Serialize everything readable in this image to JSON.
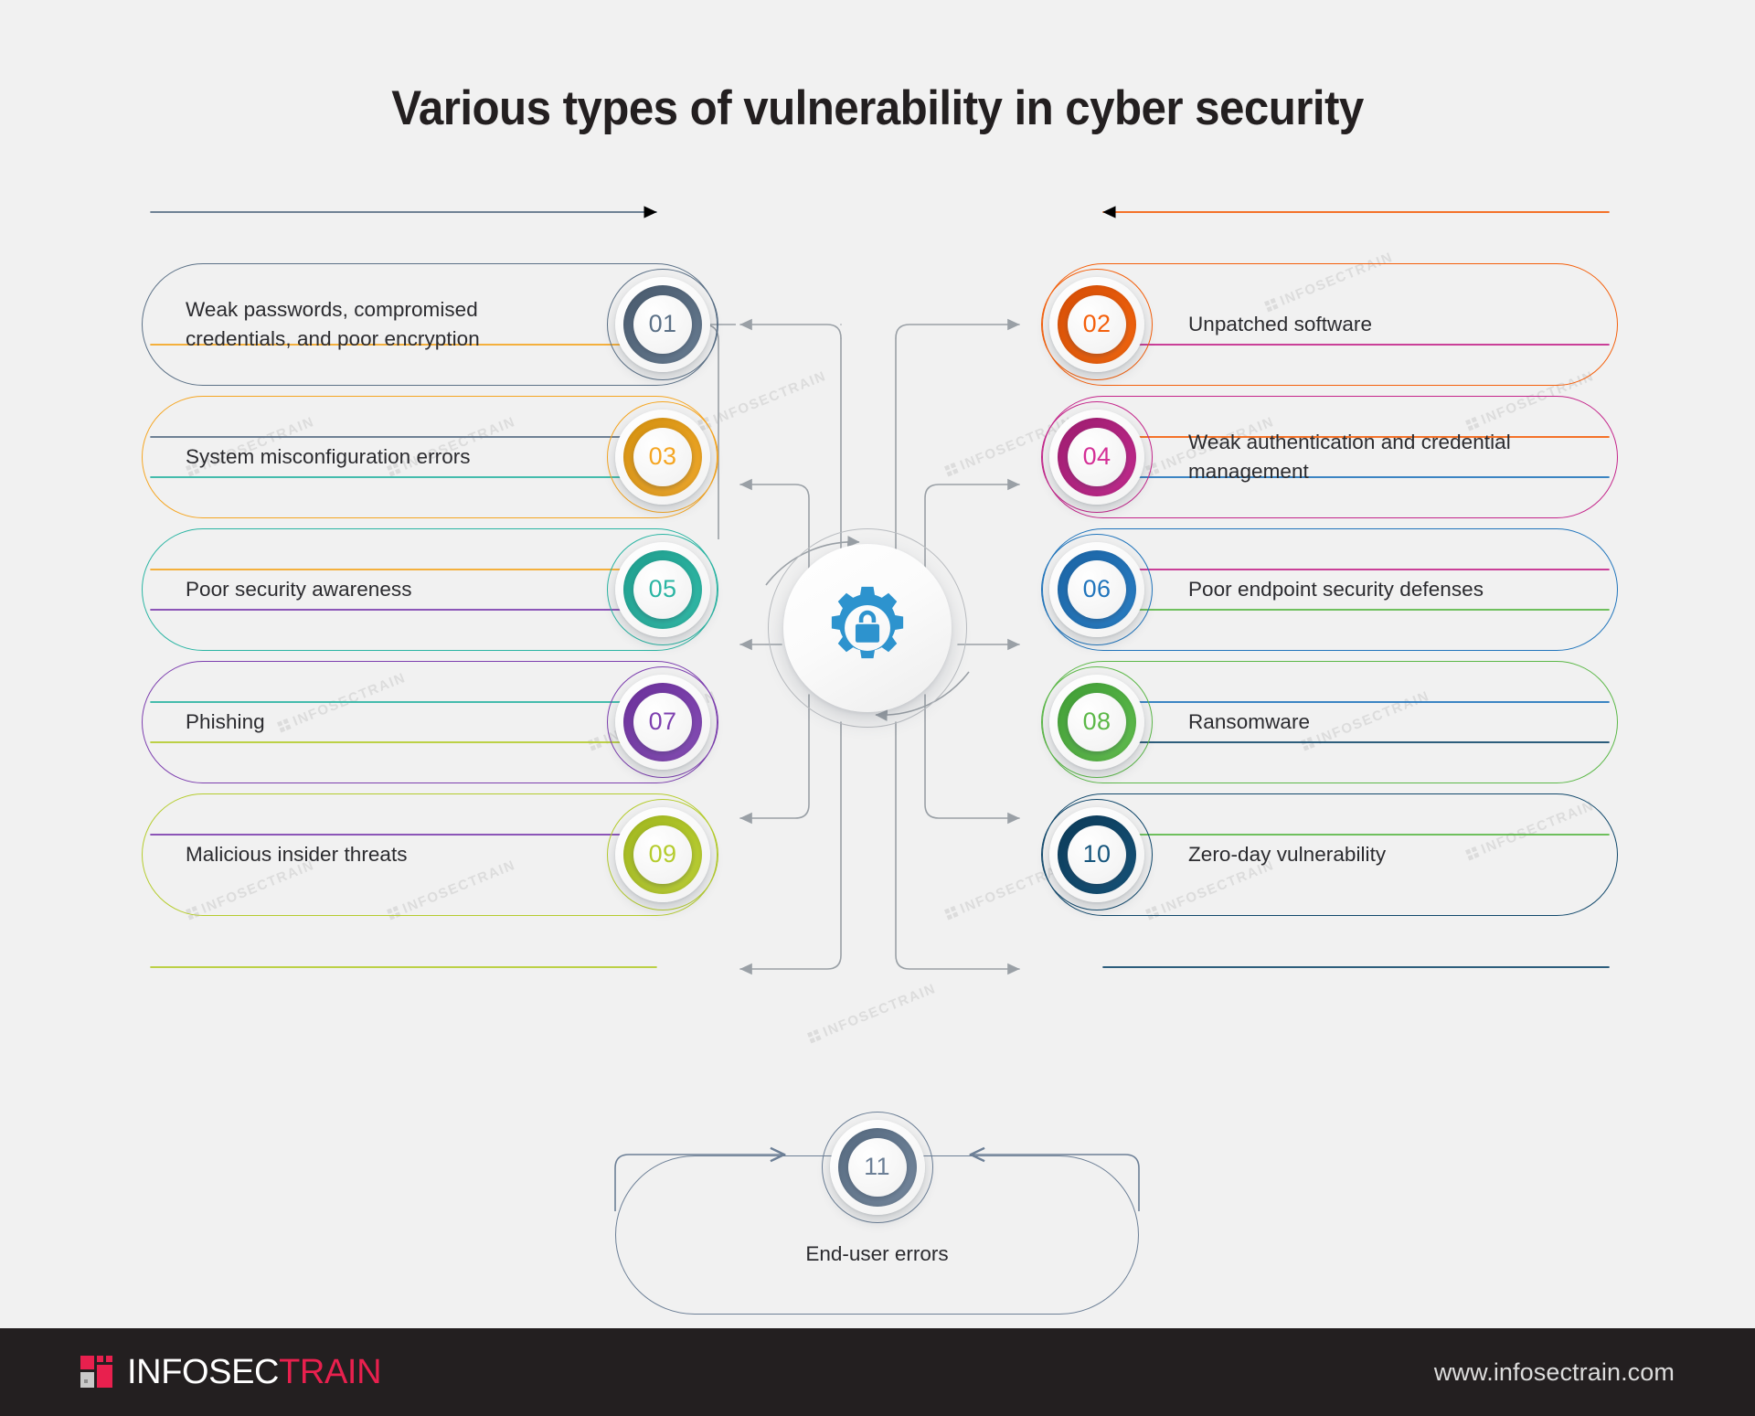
{
  "page": {
    "title": "Various types of vulnerability in cyber security",
    "background_color": "#f1f1f1",
    "watermark_text": "INFOSECTRAIN"
  },
  "hub": {
    "icon": "gear-lock-icon",
    "icon_color": "#2d93ce"
  },
  "items": [
    {
      "number": "01",
      "label": "Weak passwords, compromised credentials, and poor encryption",
      "side": "left",
      "color": "#5c7187",
      "color_dark": "#47586b",
      "color_light": "#6d8298",
      "number_color": "#5c7187"
    },
    {
      "number": "02",
      "label": "Unpatched software",
      "side": "right",
      "color": "#f4600c",
      "color_dark": "#d44d06",
      "color_light": "#fa6a10",
      "number_color": "#f4600c"
    },
    {
      "number": "03",
      "label": "System misconfiguration errors",
      "side": "left",
      "color": "#f5a623",
      "color_dark": "#d28f0f",
      "color_light": "#f7ae2e",
      "number_color": "#f5a623"
    },
    {
      "number": "04",
      "label": "Weak authentication and credential management",
      "side": "right",
      "color": "#c4268b",
      "color_dark": "#9c1c6e",
      "color_light": "#c92d93",
      "number_color": "#d42f96"
    },
    {
      "number": "05",
      "label": "Poor security awareness",
      "side": "left",
      "color": "#2bb5a3",
      "color_dark": "#1f9d8d",
      "color_light": "#34c0ad",
      "number_color": "#2bb5a3"
    },
    {
      "number": "06",
      "label": "Poor endpoint security defenses",
      "side": "right",
      "color": "#2175bc",
      "color_dark": "#1b63a3",
      "color_light": "#2c83cb",
      "number_color": "#2175bc"
    },
    {
      "number": "07",
      "label": "Phishing",
      "side": "left",
      "color": "#7d3faf",
      "color_dark": "#6a2f99",
      "color_light": "#8b52bc",
      "number_color": "#7d3faf"
    },
    {
      "number": "08",
      "label": "Ransomware",
      "side": "right",
      "color": "#5cb848",
      "color_dark": "#3f9c35",
      "color_light": "#66c452",
      "number_color": "#5cb848"
    },
    {
      "number": "09",
      "label": "Malicious insider threats",
      "side": "left",
      "color": "#b5cc2e",
      "color_dark": "#9fb51f",
      "color_light": "#c2d638",
      "number_color": "#b5cc2e"
    },
    {
      "number": "10",
      "label": "Zero-day vulnerability",
      "side": "right",
      "color": "#11486b",
      "color_dark": "#0c3a58",
      "color_light": "#17567d",
      "number_color": "#17567d"
    },
    {
      "number": "11",
      "label": "End-user errors",
      "side": "bottom",
      "color": "#6c7f96",
      "color_dark": "#54687e",
      "color_light": "#7b8ea4",
      "number_color": "#6c7f96"
    }
  ],
  "footer": {
    "brand_primary": "INFOSEC",
    "brand_secondary": "TRAIN",
    "website": "www.infosectrain.com",
    "background_color": "#231f20",
    "accent_color": "#e8204e"
  }
}
